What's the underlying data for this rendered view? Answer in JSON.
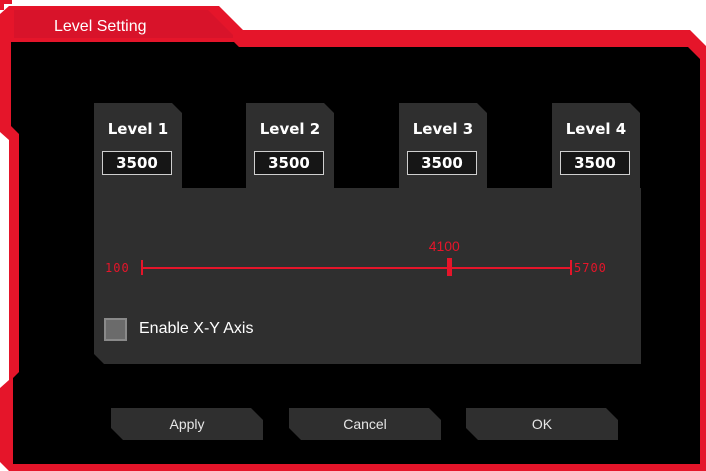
{
  "window": {
    "title": "Level Setting"
  },
  "levels": [
    {
      "label": "Level 1",
      "value": "3500"
    },
    {
      "label": "Level 2",
      "value": "3500"
    },
    {
      "label": "Level 3",
      "value": "3500"
    },
    {
      "label": "Level 4",
      "value": "3500"
    }
  ],
  "slider": {
    "min_label": "100",
    "max_label": "5700",
    "current_label": "4100",
    "min": 100,
    "max": 5700,
    "value": 4100
  },
  "xy_axis": {
    "label": "Enable X-Y Axis",
    "checked": false
  },
  "buttons": {
    "apply": "Apply",
    "cancel": "Cancel",
    "ok": "OK"
  },
  "colors": {
    "accent": "#e5152a",
    "panel": "#2f2f2f",
    "background": "#000000"
  }
}
